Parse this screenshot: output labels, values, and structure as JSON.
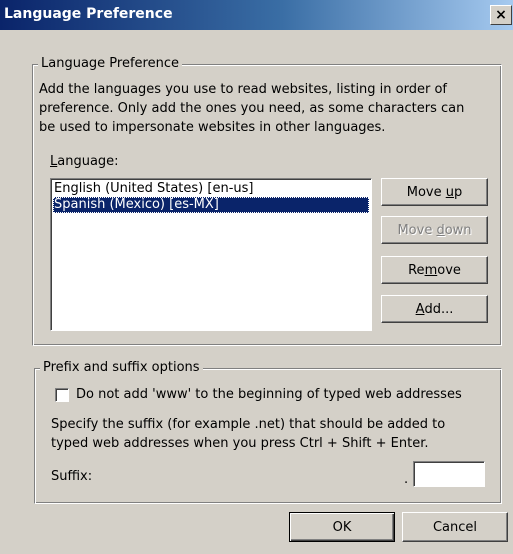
{
  "window": {
    "title": "Language Preference",
    "close_glyph": "×"
  },
  "language_group": {
    "legend": "Language Preference",
    "description_lines": [
      "Add the languages you use to read websites, listing in order of",
      "preference. Only add the ones you need, as some characters can",
      "be used to impersonate websites in other languages."
    ],
    "list_label_prefix": "",
    "list_label_mnemonic": "L",
    "list_label_rest": "anguage:",
    "languages": [
      {
        "label": "English (United States) [en-us]",
        "selected": false
      },
      {
        "label": "Spanish (Mexico) [es-MX]",
        "selected": true
      }
    ],
    "buttons": {
      "move_up": {
        "pre": "Move ",
        "mn": "u",
        "post": "p",
        "enabled": true
      },
      "move_down": {
        "pre": "Move ",
        "mn": "d",
        "post": "own",
        "enabled": false
      },
      "remove": {
        "pre": "Re",
        "mn": "m",
        "post": "ove",
        "enabled": true
      },
      "add": {
        "pre": "",
        "mn": "A",
        "post": "dd...",
        "enabled": true
      }
    }
  },
  "prefix_group": {
    "legend": "Prefix and suffix options",
    "checkbox_label": "Do not add 'www' to the beginning of typed web addresses",
    "checkbox_checked": false,
    "suffix_help_lines": [
      "Specify the suffix (for example .net) that should be added to",
      "typed web addresses when you press Ctrl + Shift + Enter."
    ],
    "suffix_label": "Suffix:",
    "suffix_dot": ".",
    "suffix_value": ""
  },
  "footer": {
    "ok_label": "OK",
    "cancel_label": "Cancel"
  },
  "colors": {
    "dialog_face": "#d4d0c8",
    "title_start": "#0a246a",
    "title_end": "#a6caf0",
    "selection": "#0a246a"
  }
}
